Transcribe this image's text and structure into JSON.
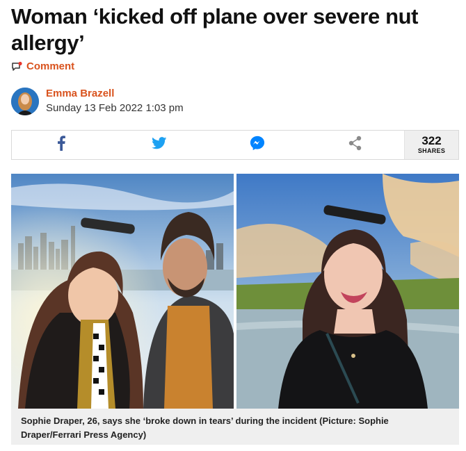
{
  "article": {
    "headline": "Woman ‘kicked off plane over severe nut allergy’",
    "comment_label": "Comment",
    "author": "Emma Brazell",
    "date": "Sunday 13 Feb 2022 1:03 pm"
  },
  "share": {
    "count": "322",
    "count_label": "SHARES",
    "buttons": [
      "facebook-icon",
      "twitter-icon",
      "messenger-icon",
      "share-icon"
    ]
  },
  "image": {
    "caption": "Sophie Draper, 26, says she ‘broke down in tears’ during the incident (Picture: Sophie Draper/Ferrari Press Agency)"
  },
  "colors": {
    "accent": "#d9531e",
    "facebook": "#3b5998",
    "twitter": "#1da1f2",
    "messenger": "#0084ff",
    "share_grey": "#8a8a8a"
  }
}
